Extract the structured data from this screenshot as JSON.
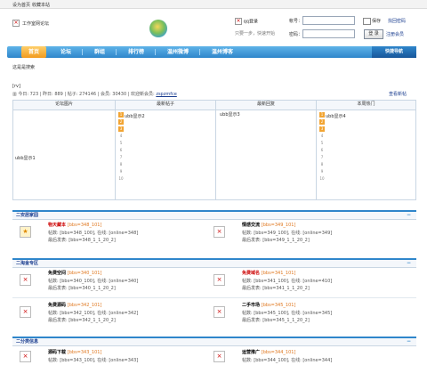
{
  "topbar": {
    "set_home": "设为首页",
    "bookmark": "收藏本站"
  },
  "header": {
    "site_name": "工作室网论坛",
    "qq_login": "qq登录",
    "qq_hint": "只要一步，快速开始",
    "account_label": "帐号：",
    "password_label": "密码：",
    "remember_label": "保存",
    "forgot_label": "找回密码",
    "login_button": "登 录",
    "register_label": "注册会员"
  },
  "nav": {
    "items": [
      "首页",
      "论坛",
      "群组",
      "排行榜",
      "温州微博",
      "温州博客"
    ],
    "active": 0,
    "quick": "快捷导航"
  },
  "welcome": "这是是搜索",
  "rss": "[rv]",
  "stats": {
    "today_label": "今日:",
    "today": "723",
    "yesterday_label": "昨日:",
    "yesterday": "889",
    "posts_label": "帖子:",
    "posts": "274146",
    "members_label": "会员:",
    "members": "30430",
    "welcome_label": "欢迎新会员:",
    "new_member": "zspzmfce",
    "newest_link": "查看新帖"
  },
  "top_table": {
    "headers": [
      "论坛图片",
      "最新帖子",
      "最新回复",
      "本周热门"
    ],
    "image_text": "ubb显示1",
    "col2": "ubb显示2",
    "col3": "ubb显示3",
    "col4": "ubb显示4",
    "numbers": [
      "1",
      "2",
      "3",
      "4",
      "5",
      "6",
      "7",
      "8",
      "9",
      "10"
    ]
  },
  "sections": [
    {
      "title": "二安居家园",
      "forums": [
        {
          "name": "物天藏本",
          "code": "[bbs=348_101]",
          "posts": "帖数: [bbs=348_100], 在线: [online=348]",
          "last": "最后发表: [bbs=348_1_1_20_2]"
        },
        {
          "name": "情感交流",
          "code": "[bbs=349_101]",
          "posts": "帖数: [bbs=349_100], 在线: [online=349]",
          "last": "最后发表: [bbs=349_1_1_20_2]"
        }
      ]
    },
    {
      "title": "二淘金专区",
      "forums": [
        {
          "name": "免费空间",
          "code": "[bbs=340_101]",
          "posts": "帖数: [bbs=340_100], 在线: [online=340]",
          "last": "最后发表: [bbs=340_1_1_20_2]"
        },
        {
          "name": "免费域名",
          "code": "[bbs=341_101]",
          "posts": "帖数: [bbs=341_100], 在线: [online=410]",
          "last": "最后发表: [bbs=341_1_1_20_2]"
        },
        {
          "name": "免费源码",
          "code": "[bbs=342_101]",
          "posts": "帖数: [bbs=342_100], 在线: [online=342]",
          "last": "最后发表: [bbs=342_1_1_20_2]"
        },
        {
          "name": "二手市场",
          "code": "[bbs=345_101]",
          "posts": "帖数: [bbs=345_100], 在线: [online=345]",
          "last": "最后发表: [bbs=345_1_1_20_2]"
        }
      ]
    },
    {
      "title": "二分类信息",
      "forums": [
        {
          "name": "源码下载",
          "code": "[bbs=343_101]",
          "posts": "帖数: [bbs=343_100], 在线: [online=343]",
          "last": ""
        },
        {
          "name": "运营推广",
          "code": "[bbs=344_101]",
          "posts": "帖数: [bbs=344_100], 在线: [online=344]",
          "last": ""
        }
      ]
    }
  ]
}
